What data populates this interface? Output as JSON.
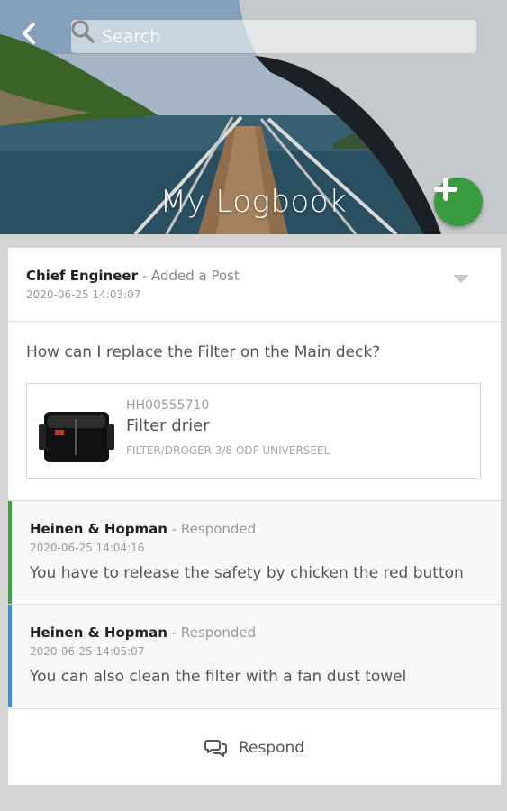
{
  "header": {
    "title": "My Logbook",
    "search_placeholder": "Search"
  },
  "icons": {
    "back": "back-arrow-icon",
    "search": "search-icon",
    "add": "plus-icon",
    "expand": "chevron-down-icon",
    "respond": "chat-bubbles-icon"
  },
  "colors": {
    "fab": "#3a9a3e",
    "response_1_accent": "#3aa33e",
    "response_2_accent": "#3b8de0"
  },
  "post": {
    "author": "Chief Engineer",
    "action": "- Added a Post",
    "timestamp": "2020-06-25 14:03:07",
    "question": "How can I replace the Filter on the Main deck?",
    "product": {
      "code": "HH00555710",
      "name": "Filter drier",
      "description": "FILTER/DROGER 3/8 ODF UNIVERSEEL"
    }
  },
  "responses": [
    {
      "author": "Heinen & Hopman",
      "action": "- Responded",
      "timestamp": "2020-06-25 14:04:16",
      "text": "You have to release the safety by chicken the red button"
    },
    {
      "author": "Heinen & Hopman",
      "action": "- Responded",
      "timestamp": "2020-06-25 14:05:07",
      "text": "You can also clean the filter with a fan dust towel"
    }
  ],
  "respond_label": "Respond"
}
